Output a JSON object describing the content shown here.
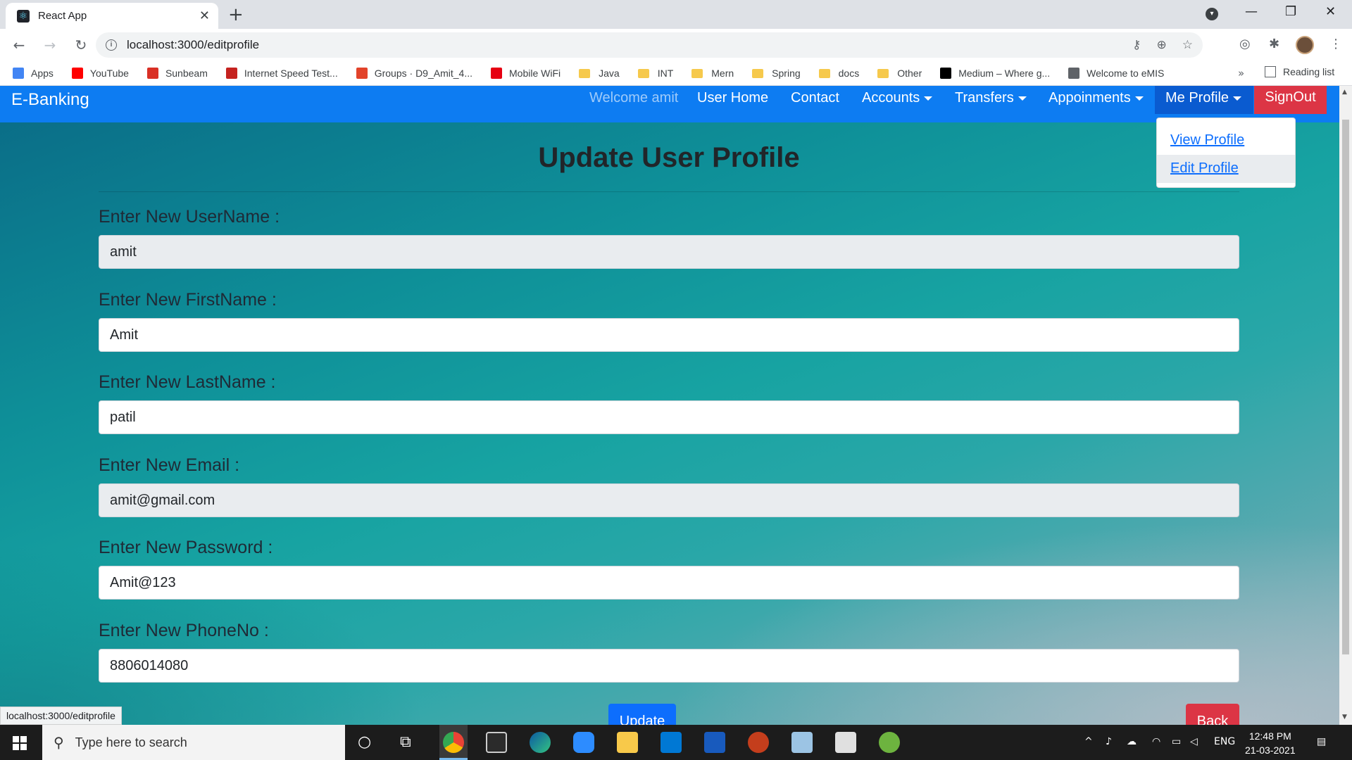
{
  "browser": {
    "tab_title": "React App",
    "url": "localhost:3000/editprofile",
    "bookmarks": [
      {
        "label": "Apps",
        "color": "#4285f4"
      },
      {
        "label": "YouTube",
        "color": "#ff0000"
      },
      {
        "label": "Sunbeam",
        "color": "#d93025"
      },
      {
        "label": "Internet Speed Test...",
        "color": "#c5221f"
      },
      {
        "label": "Groups · D9_Amit_4...",
        "color": "#e2432a"
      },
      {
        "label": "Mobile WiFi",
        "color": "#e60012"
      },
      {
        "label": "Java",
        "folder": true
      },
      {
        "label": "INT",
        "folder": true
      },
      {
        "label": "Mern",
        "folder": true
      },
      {
        "label": "Spring",
        "folder": true
      },
      {
        "label": "docs",
        "folder": true
      },
      {
        "label": "Other",
        "folder": true
      },
      {
        "label": "Medium – Where g...",
        "color": "#000000"
      },
      {
        "label": "Welcome to eMIS",
        "color": "#5f6368"
      }
    ],
    "more": "»",
    "reading_list": "Reading list",
    "status_url": "localhost:3000/editprofile"
  },
  "navbar": {
    "brand": "E-Banking",
    "welcome": "Welcome amit",
    "user_home": "User Home",
    "contact": "Contact",
    "accounts": "Accounts",
    "transfers": "Transfers",
    "appointments": "Appoinments",
    "me_profile": "Me Profile",
    "signout": "SignOut"
  },
  "dropdown": {
    "view_profile": "View Profile",
    "edit_profile": "Edit Profile"
  },
  "form": {
    "title": "Update User Profile",
    "fields": [
      {
        "label": "Enter New UserName :",
        "value": "amit",
        "readonly": true
      },
      {
        "label": "Enter New FirstName :",
        "value": "Amit",
        "readonly": false
      },
      {
        "label": "Enter New LastName :",
        "value": "patil",
        "readonly": false
      },
      {
        "label": "Enter New Email :",
        "value": "amit@gmail.com",
        "readonly": true
      },
      {
        "label": "Enter New Password :",
        "value": "Amit@123",
        "readonly": false
      },
      {
        "label": "Enter New PhoneNo :",
        "value": "8806014080",
        "readonly": false
      }
    ],
    "update_label": "Update",
    "back_label": "Back"
  },
  "taskbar": {
    "search_placeholder": "Type here to search",
    "language": "ENG",
    "time": "12:48 PM",
    "date": "21-03-2021"
  },
  "colors": {
    "navbar": "#0d7cf2",
    "signout": "#dc3545",
    "update": "#0d6efd"
  }
}
